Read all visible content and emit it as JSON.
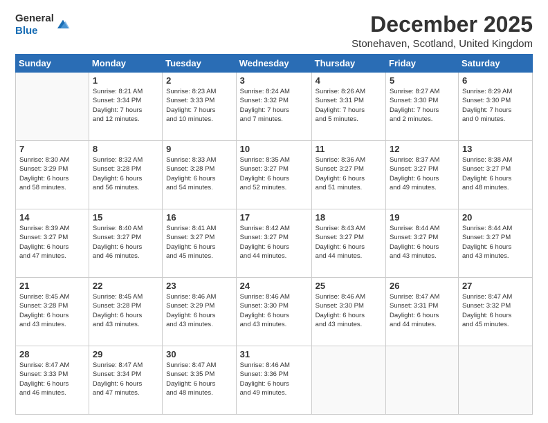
{
  "header": {
    "logo_general": "General",
    "logo_blue": "Blue",
    "title": "December 2025",
    "subtitle": "Stonehaven, Scotland, United Kingdom"
  },
  "days_of_week": [
    "Sunday",
    "Monday",
    "Tuesday",
    "Wednesday",
    "Thursday",
    "Friday",
    "Saturday"
  ],
  "weeks": [
    [
      {
        "day": "",
        "info": ""
      },
      {
        "day": "1",
        "info": "Sunrise: 8:21 AM\nSunset: 3:34 PM\nDaylight: 7 hours\nand 12 minutes."
      },
      {
        "day": "2",
        "info": "Sunrise: 8:23 AM\nSunset: 3:33 PM\nDaylight: 7 hours\nand 10 minutes."
      },
      {
        "day": "3",
        "info": "Sunrise: 8:24 AM\nSunset: 3:32 PM\nDaylight: 7 hours\nand 7 minutes."
      },
      {
        "day": "4",
        "info": "Sunrise: 8:26 AM\nSunset: 3:31 PM\nDaylight: 7 hours\nand 5 minutes."
      },
      {
        "day": "5",
        "info": "Sunrise: 8:27 AM\nSunset: 3:30 PM\nDaylight: 7 hours\nand 2 minutes."
      },
      {
        "day": "6",
        "info": "Sunrise: 8:29 AM\nSunset: 3:30 PM\nDaylight: 7 hours\nand 0 minutes."
      }
    ],
    [
      {
        "day": "7",
        "info": "Sunrise: 8:30 AM\nSunset: 3:29 PM\nDaylight: 6 hours\nand 58 minutes."
      },
      {
        "day": "8",
        "info": "Sunrise: 8:32 AM\nSunset: 3:28 PM\nDaylight: 6 hours\nand 56 minutes."
      },
      {
        "day": "9",
        "info": "Sunrise: 8:33 AM\nSunset: 3:28 PM\nDaylight: 6 hours\nand 54 minutes."
      },
      {
        "day": "10",
        "info": "Sunrise: 8:35 AM\nSunset: 3:27 PM\nDaylight: 6 hours\nand 52 minutes."
      },
      {
        "day": "11",
        "info": "Sunrise: 8:36 AM\nSunset: 3:27 PM\nDaylight: 6 hours\nand 51 minutes."
      },
      {
        "day": "12",
        "info": "Sunrise: 8:37 AM\nSunset: 3:27 PM\nDaylight: 6 hours\nand 49 minutes."
      },
      {
        "day": "13",
        "info": "Sunrise: 8:38 AM\nSunset: 3:27 PM\nDaylight: 6 hours\nand 48 minutes."
      }
    ],
    [
      {
        "day": "14",
        "info": "Sunrise: 8:39 AM\nSunset: 3:27 PM\nDaylight: 6 hours\nand 47 minutes."
      },
      {
        "day": "15",
        "info": "Sunrise: 8:40 AM\nSunset: 3:27 PM\nDaylight: 6 hours\nand 46 minutes."
      },
      {
        "day": "16",
        "info": "Sunrise: 8:41 AM\nSunset: 3:27 PM\nDaylight: 6 hours\nand 45 minutes."
      },
      {
        "day": "17",
        "info": "Sunrise: 8:42 AM\nSunset: 3:27 PM\nDaylight: 6 hours\nand 44 minutes."
      },
      {
        "day": "18",
        "info": "Sunrise: 8:43 AM\nSunset: 3:27 PM\nDaylight: 6 hours\nand 44 minutes."
      },
      {
        "day": "19",
        "info": "Sunrise: 8:44 AM\nSunset: 3:27 PM\nDaylight: 6 hours\nand 43 minutes."
      },
      {
        "day": "20",
        "info": "Sunrise: 8:44 AM\nSunset: 3:27 PM\nDaylight: 6 hours\nand 43 minutes."
      }
    ],
    [
      {
        "day": "21",
        "info": "Sunrise: 8:45 AM\nSunset: 3:28 PM\nDaylight: 6 hours\nand 43 minutes."
      },
      {
        "day": "22",
        "info": "Sunrise: 8:45 AM\nSunset: 3:28 PM\nDaylight: 6 hours\nand 43 minutes."
      },
      {
        "day": "23",
        "info": "Sunrise: 8:46 AM\nSunset: 3:29 PM\nDaylight: 6 hours\nand 43 minutes."
      },
      {
        "day": "24",
        "info": "Sunrise: 8:46 AM\nSunset: 3:30 PM\nDaylight: 6 hours\nand 43 minutes."
      },
      {
        "day": "25",
        "info": "Sunrise: 8:46 AM\nSunset: 3:30 PM\nDaylight: 6 hours\nand 43 minutes."
      },
      {
        "day": "26",
        "info": "Sunrise: 8:47 AM\nSunset: 3:31 PM\nDaylight: 6 hours\nand 44 minutes."
      },
      {
        "day": "27",
        "info": "Sunrise: 8:47 AM\nSunset: 3:32 PM\nDaylight: 6 hours\nand 45 minutes."
      }
    ],
    [
      {
        "day": "28",
        "info": "Sunrise: 8:47 AM\nSunset: 3:33 PM\nDaylight: 6 hours\nand 46 minutes."
      },
      {
        "day": "29",
        "info": "Sunrise: 8:47 AM\nSunset: 3:34 PM\nDaylight: 6 hours\nand 47 minutes."
      },
      {
        "day": "30",
        "info": "Sunrise: 8:47 AM\nSunset: 3:35 PM\nDaylight: 6 hours\nand 48 minutes."
      },
      {
        "day": "31",
        "info": "Sunrise: 8:46 AM\nSunset: 3:36 PM\nDaylight: 6 hours\nand 49 minutes."
      },
      {
        "day": "",
        "info": ""
      },
      {
        "day": "",
        "info": ""
      },
      {
        "day": "",
        "info": ""
      }
    ]
  ]
}
